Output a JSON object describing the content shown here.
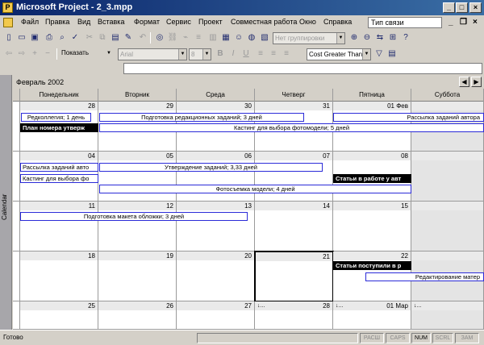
{
  "window": {
    "title": "Microsoft Project - 2_3.mpp"
  },
  "menu": {
    "items": [
      "Файл",
      "Правка",
      "Вид",
      "Вставка",
      "Формат",
      "Сервис",
      "Проект",
      "Совместная работа",
      "Окно",
      "Справка"
    ],
    "help_placeholder": "Тип связи"
  },
  "toolbar": {
    "grouping": "Нет группировки",
    "show_label": "Показать",
    "font": "Arial",
    "font_size": "8",
    "filter": "Cost Greater Than"
  },
  "calendar": {
    "view_label": "Calendar",
    "month": "Февраль 2002",
    "days": [
      "Понедельник",
      "Вторник",
      "Среда",
      "Четверг",
      "Пятница",
      "Суббота"
    ],
    "weeks": [
      {
        "dates": [
          "28",
          "29",
          "30",
          "31",
          "01 Фев",
          ""
        ]
      },
      {
        "dates": [
          "04",
          "05",
          "06",
          "07",
          "08",
          ""
        ]
      },
      {
        "dates": [
          "11",
          "12",
          "13",
          "14",
          "15",
          ""
        ]
      },
      {
        "dates": [
          "18",
          "19",
          "20",
          "21",
          "22",
          ""
        ]
      },
      {
        "dates": [
          "25",
          "26",
          "27",
          "28",
          "01 Мар",
          ""
        ]
      }
    ],
    "more_marker": "↓...",
    "tasks": {
      "t1": "Редколлегия; 1 день",
      "t2": "Подготовка редакционных заданий; 3 дней",
      "t3": "Рассылка заданий автора",
      "t4": "План номера утверж",
      "t5": "Кастинг для выбора фотомодели; 5 дней",
      "t6": "Рассылка заданий авто",
      "t7": "Утверждение заданий; 3,33 дней",
      "t8": "Кастинг для выбора фо",
      "t9": "Статьи в работе у авт",
      "t10": "Фотосъемка модели; 4 дней",
      "t11": "Подготовка макета обложки; 3 дней",
      "t12": "Статьи поступили в р",
      "t13": "Редактирование матер"
    }
  },
  "status": {
    "text": "Готово",
    "indicators": [
      "РАСШ",
      "CAPS",
      "NUM",
      "SCRL",
      "ЗАМ"
    ]
  }
}
